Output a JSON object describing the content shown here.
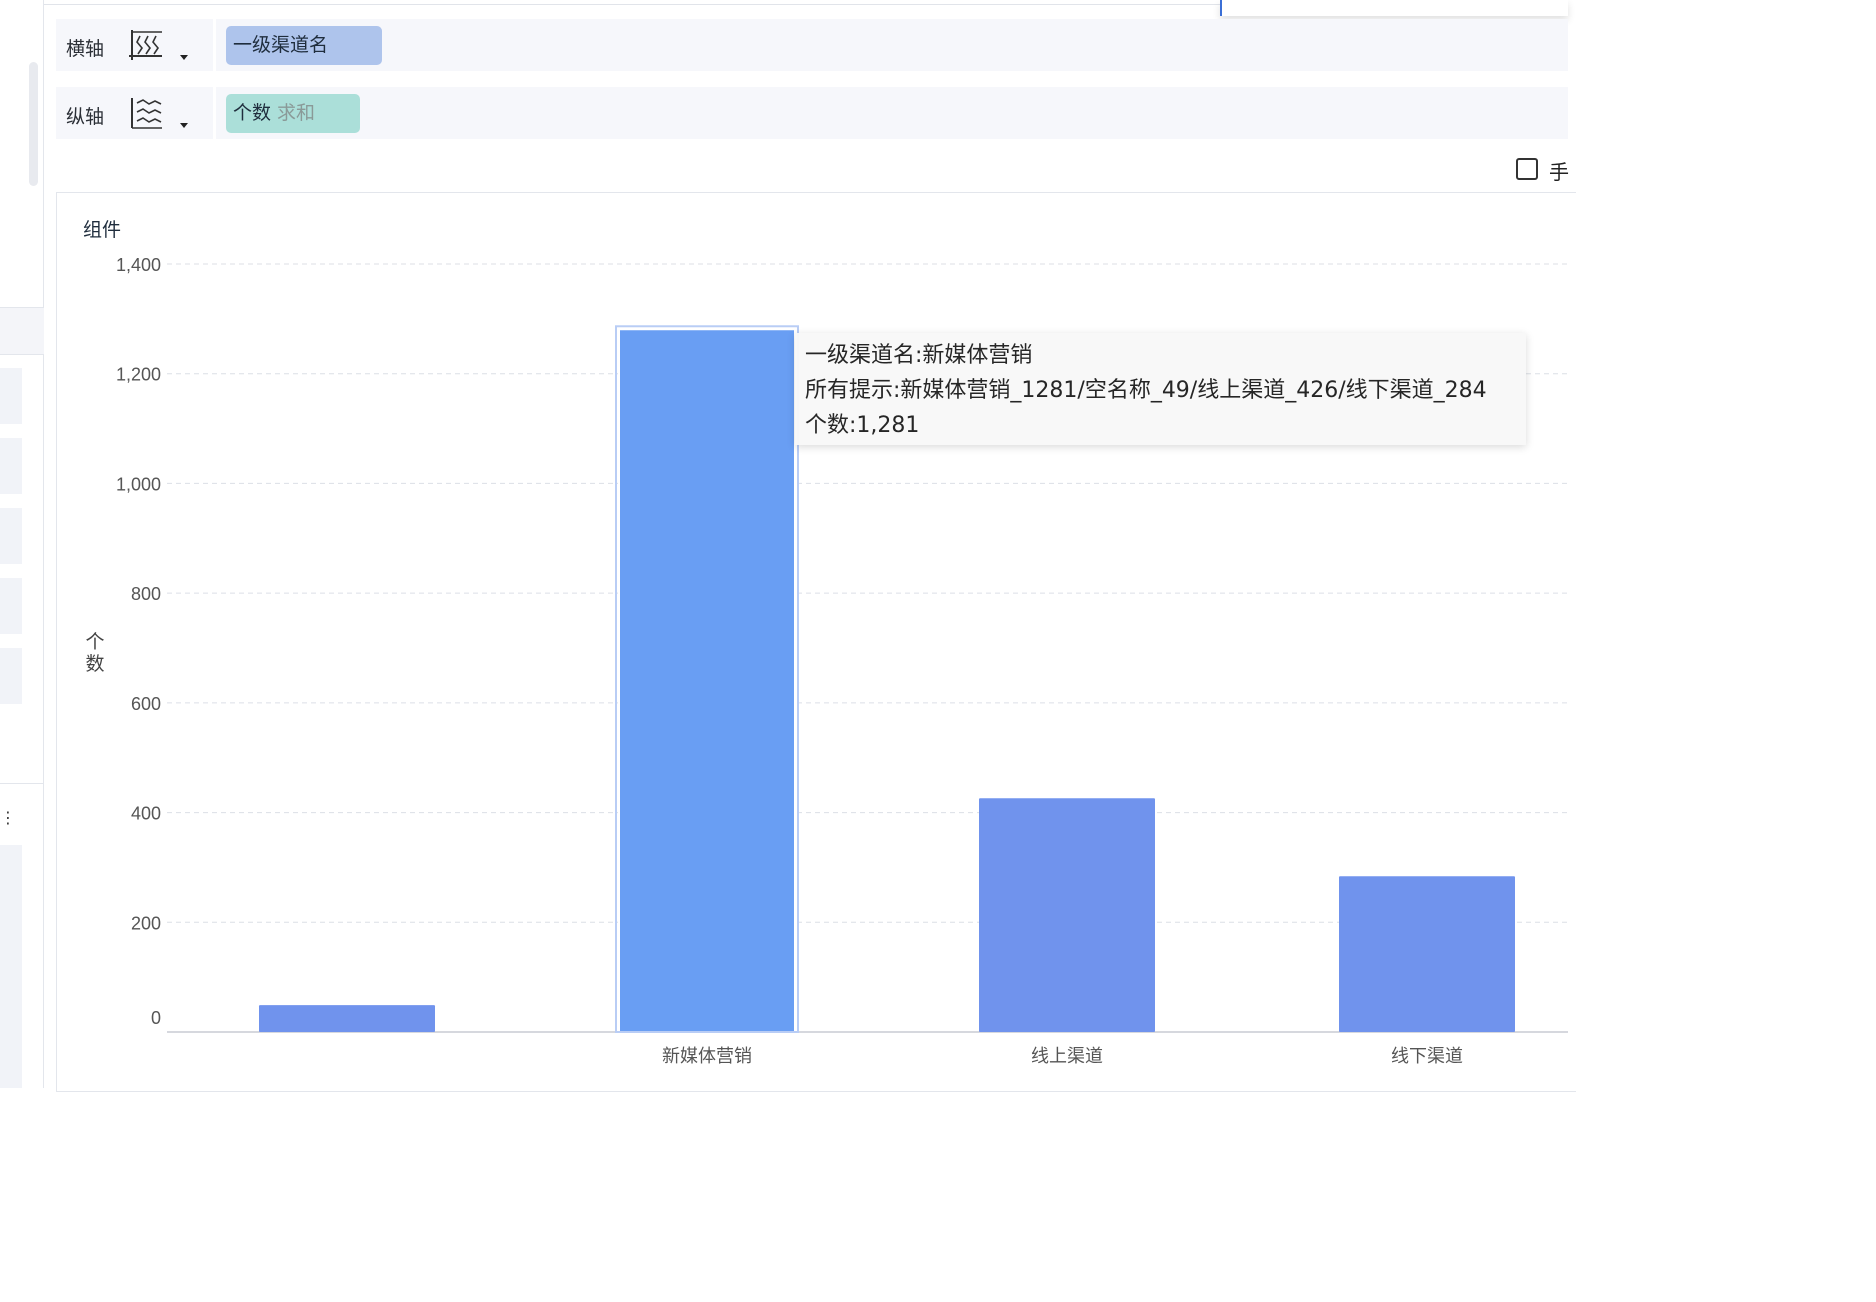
{
  "axes_config": {
    "x_axis": {
      "label": "横轴",
      "field": "一级渠道名"
    },
    "y_axis": {
      "label": "纵轴",
      "field": "个数",
      "aggregation": "求和"
    }
  },
  "checkbox": {
    "label": "手",
    "checked": false
  },
  "chart": {
    "title": "组件"
  },
  "tooltip": {
    "line1": "一级渠道名:新媒体营销",
    "line2": "所有提示:新媒体营销_1281/空名称_49/线上渠道_426/线下渠道_284",
    "line3": "个数:1,281"
  },
  "colors": {
    "bar": "#7093ed",
    "bar_highlight": "#699ef3",
    "pill_x": "#aec4ec",
    "pill_y": "#abdfd9"
  },
  "chart_data": {
    "type": "bar",
    "title": "组件",
    "xlabel": "",
    "ylabel": "个数",
    "categories": [
      "",
      "新媒体营销",
      "线上渠道",
      "线下渠道"
    ],
    "values": [
      49,
      1281,
      426,
      284
    ],
    "ylim": [
      0,
      1400
    ],
    "yticks": [
      0,
      200,
      400,
      600,
      800,
      1000,
      1200,
      1400
    ],
    "ytick_labels": [
      "0",
      "200",
      "400",
      "600",
      "800",
      "1,000",
      "1,200",
      "1,400"
    ],
    "grid": true,
    "highlighted_index": 1
  }
}
